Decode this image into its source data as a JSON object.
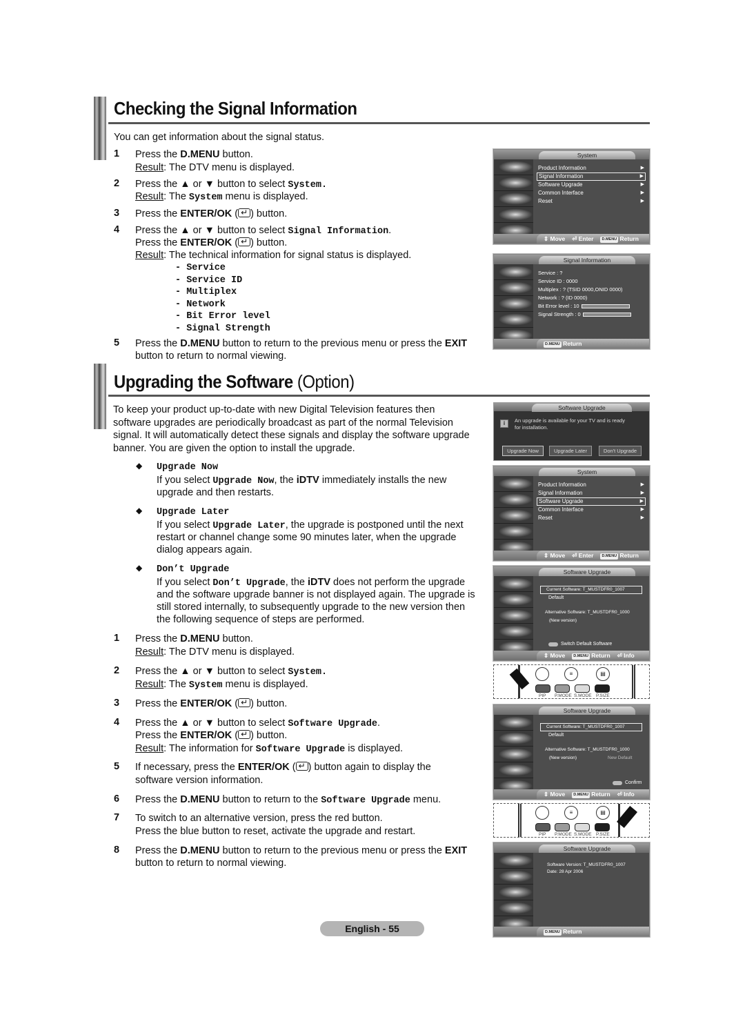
{
  "section1": {
    "title": "Checking the Signal Information",
    "intro": "You can get information about the signal status.",
    "steps": [
      {
        "num": "1",
        "line1_pre": "Press the ",
        "line1_bold": "D.MENU",
        "line1_post": " button.",
        "result_label": "Result",
        "result_text": ":  The DTV menu is displayed."
      },
      {
        "num": "2",
        "line1_pre": "Press the ▲ or ▼ button to select ",
        "line1_mono": "System.",
        "result_label": "Result",
        "result_pre": ":  The ",
        "result_mono": "System",
        "result_post": " menu is displayed."
      },
      {
        "num": "3",
        "line1_pre": "Press the ",
        "line1_bold": "ENTER/OK",
        "line1_post": " button."
      },
      {
        "num": "4",
        "line1_pre": "Press the ▲ or ▼ button to select ",
        "line1_mono": "Signal Information",
        "line1_post": ".",
        "line2_pre": "Press the ",
        "line2_bold": "ENTER/OK",
        "line2_post": " button.",
        "result_label": "Result",
        "result_text": ":  The technical information for signal status is displayed."
      },
      {
        "num": "5",
        "line1_pre": "Press the ",
        "line1_bold": "D.MENU",
        "line1_mid": " button to return to the previous menu or press the ",
        "line1_bold2": "EXIT",
        "line2": "button to return to normal viewing."
      }
    ],
    "signal_items": [
      "- Service",
      "- Service ID",
      "- Multiplex",
      "- Network",
      "- Bit Error level",
      "- Signal Strength"
    ]
  },
  "section2": {
    "title": "Upgrading the Software",
    "title_option": "(Option)",
    "intro": [
      "To keep your product up-to-date with new Digital Television features then",
      "software upgrades are periodically broadcast as part of the normal Television",
      "signal. It will automatically detect these signals and display the software upgrade",
      "banner. You are given the option to install the upgrade."
    ],
    "options": [
      {
        "title": "Upgrade Now",
        "lines": [
          [
            "If you select ",
            "Upgrade Now",
            ", the ",
            "iDTV",
            " immediately installs the new"
          ],
          "upgrade and then restarts."
        ]
      },
      {
        "title": "Upgrade Later",
        "lines": [
          [
            "If you select ",
            "Upgrade Later",
            ", the upgrade is postponed until the next"
          ],
          "restart or channel change some 90 minutes later, when the upgrade",
          "dialog appears again."
        ]
      },
      {
        "title": "Don’t Upgrade",
        "lines": [
          [
            "If you select ",
            "Don’t Upgrade",
            ", the ",
            "iDTV",
            " does not perform the upgrade"
          ],
          "and the software upgrade banner is not displayed again. The upgrade is",
          "still stored internally, to subsequently upgrade to the new version then",
          "the following sequence of steps are performed."
        ]
      }
    ],
    "steps": [
      {
        "num": "1",
        "a": "Press the ",
        "b": "D.MENU",
        "c": " button.",
        "result": ":  The DTV menu is displayed."
      },
      {
        "num": "2",
        "a": "Press the ▲ or ▼ button to select ",
        "m": "System.",
        "result_pre": ":  The ",
        "result_mono": "System",
        "result_post": " menu is displayed."
      },
      {
        "num": "3",
        "a": "Press the ",
        "b": "ENTER/OK",
        "c": " button."
      },
      {
        "num": "4",
        "a": "Press the ▲ or ▼ button to select ",
        "m": "Software Upgrade",
        "c": ".",
        "l2a": "Press the ",
        "l2b": "ENTER/OK",
        "l2c": " button.",
        "result_pre": ":  The information for ",
        "result_mono": "Software Upgrade",
        "result_post": " is displayed."
      },
      {
        "num": "5",
        "a": "If necessary, press the ",
        "b": "ENTER/OK",
        "c": " button again to display the",
        "l2": "software version information."
      },
      {
        "num": "6",
        "a": "Press the ",
        "b": "D.MENU",
        "c": " button to return to the ",
        "m": "Software Upgrade",
        "d": " menu."
      },
      {
        "num": "7",
        "a": "To switch to an alternative version, press the red button.",
        "l2": "Press the blue button to reset, activate the upgrade and restart."
      },
      {
        "num": "8",
        "a": "Press the ",
        "b": "D.MENU",
        "c": " button to return to the previous menu or press the ",
        "b2": "EXIT",
        "l2": "button to return to normal viewing."
      }
    ],
    "result_label": "Result"
  },
  "screens": {
    "system_menu": {
      "title": "System",
      "items": [
        "Product Information",
        "Signal Information",
        "Software Upgrade",
        "Common Interface",
        "Reset"
      ],
      "footer": {
        "move": "Move",
        "enter": "Enter",
        "dmenu": "D.MENU",
        "return": "Return"
      }
    },
    "signal_info": {
      "title": "Signal Information",
      "lines": [
        "Service : ?",
        "Service ID : 0000",
        "Multiplex : ? (TSID 0000,ONID 0000)",
        "Network : ? (ID 0000)"
      ],
      "bit_error_label": "Bit Error level :   10",
      "signal_strength_label": "Signal Strength :  0",
      "bit_error_level": 10,
      "signal_strength": 0,
      "footer_return": "Return"
    },
    "upgrade_popup": {
      "title": "Software Upgrade",
      "message1": "An upgrade is available for your TV and is ready",
      "message2": "for installation.",
      "buttons": [
        "Upgrade Now",
        "Upgrade Later",
        "Don't Upgrade"
      ]
    },
    "software_upgrade": {
      "title": "Software Upgrade",
      "current": "Current Software: T_MUSTDFR0_1007",
      "default": "Default",
      "alternative": "Alternative Software: T_MUSTDFR0_1000",
      "new_version": "(New version)",
      "new_default": "New Default",
      "switch_label": "Switch Default Software",
      "confirm_label": "Confirm",
      "footer": {
        "move": "Move",
        "return": "Return",
        "info": "Info"
      }
    },
    "version_info": {
      "title": "Software Upgrade",
      "version": "Software Version: T_MUSTDFR0_1007",
      "date": "Date: 28 Apr 2006",
      "footer_return": "Return"
    },
    "remote": {
      "labels": [
        "PIP",
        "P.MODE",
        "S.MODE",
        "P.SIZE"
      ],
      "colors": [
        "#5a5a5a",
        "#9a9a9a",
        "#dcdcdc",
        "#1e1e1e"
      ]
    }
  },
  "footer": {
    "page_label": "English - 55"
  }
}
